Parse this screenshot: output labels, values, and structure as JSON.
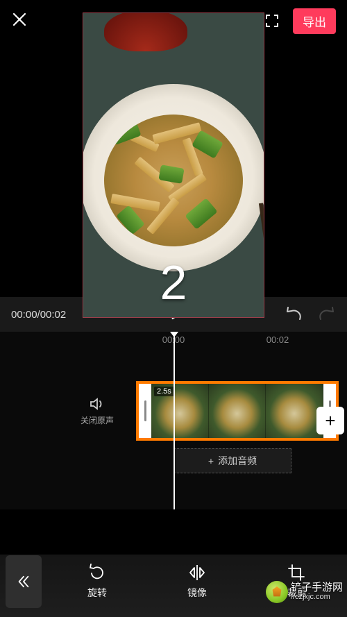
{
  "header": {
    "export_label": "导出"
  },
  "preview": {
    "overlay_number": "2"
  },
  "playbar": {
    "time_display": "00:00/00:02"
  },
  "timeline": {
    "ticks": [
      "00:00",
      "00:02"
    ],
    "mute_label": "关闭原声",
    "clip_duration": "2.5s",
    "add_clip_hint": "添加",
    "add_audio_label": "添加音频"
  },
  "toolbar": {
    "rotate_label": "旋转",
    "mirror_label": "镜像",
    "crop_label": "裁剪"
  },
  "watermark": {
    "text": "铲子手游网",
    "url": "//czjxjc.com"
  }
}
